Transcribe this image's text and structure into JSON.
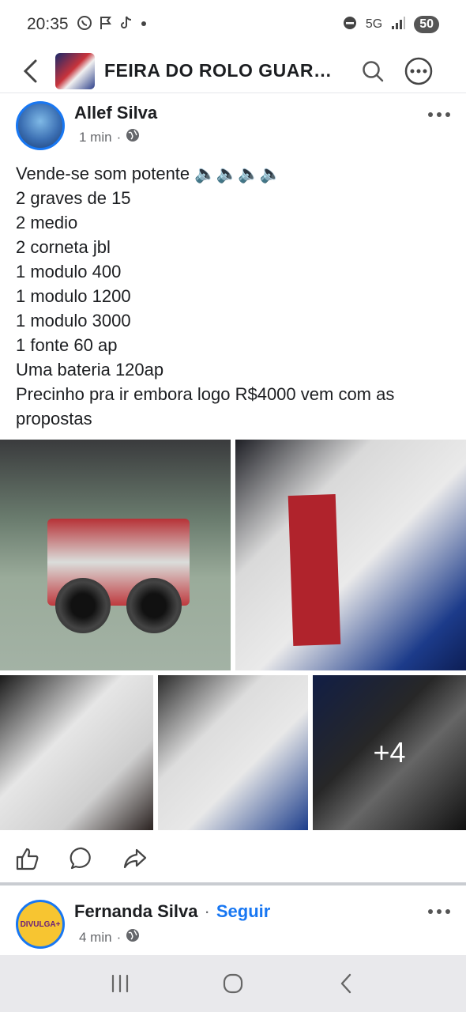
{
  "status_bar": {
    "time": "20:35",
    "network": "5G",
    "battery": "50"
  },
  "header": {
    "group_title": "FEIRA DO ROLO  GUARU..."
  },
  "post": {
    "author": "Allef Silva",
    "time": "1 min",
    "body_lines": [
      "Vende-se som potente 🔈🔈🔈🔈",
      "2 graves de 15",
      "2 medio",
      "2 corneta jbl",
      "1 modulo 400",
      "1 modulo 1200",
      "1 modulo 3000",
      "1 fonte 60 ap",
      "Uma bateria 120ap",
      "Precinho pra ir embora logo R$4000 vem com as",
      "propostas"
    ],
    "more_photos": "+4"
  },
  "post2": {
    "author": "Fernanda Silva",
    "separator": "·",
    "follow_label": "Seguir",
    "time": "4 min",
    "avatar_text": "DIVULGA+"
  },
  "colors": {
    "accent": "#1877f2",
    "secondary_text": "#65676b"
  }
}
